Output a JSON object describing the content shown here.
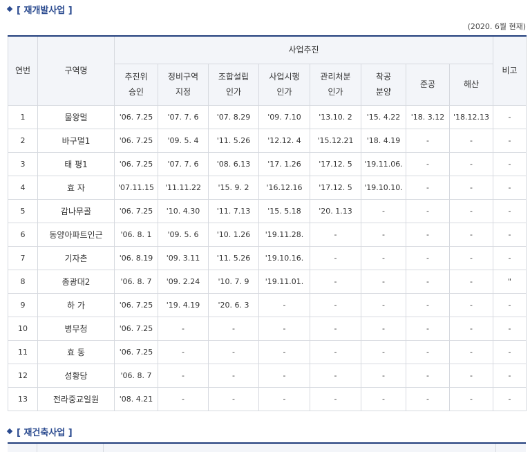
{
  "section1": {
    "title": "[ 재개발사업 ]"
  },
  "note": "(2020. 6월 현재)",
  "table": {
    "header": {
      "col_no": "연번",
      "col_name": "구역명",
      "group": "사업추진",
      "col_remark": "비고",
      "steps": [
        [
          "추진위",
          "승인"
        ],
        [
          "정비구역",
          "지정"
        ],
        [
          "조합설립",
          "인가"
        ],
        [
          "사업시행",
          "인가"
        ],
        [
          "관리처분",
          "인가"
        ],
        [
          "착공",
          "분양"
        ],
        [
          "준공"
        ],
        [
          "해산"
        ]
      ]
    },
    "rows": [
      [
        "1",
        "물왕멀",
        "'06. 7.25",
        "'07. 7. 6",
        "'07. 8.29",
        "'09. 7.10",
        "'13.10. 2",
        "'15. 4.22",
        "'18. 3.12",
        "'18.12.13",
        "-"
      ],
      [
        "2",
        "바구멀1",
        "'06. 7.25",
        "'09. 5. 4",
        "'11. 5.26",
        "'12.12. 4",
        "'15.12.21",
        "'18. 4.19",
        "-",
        "-",
        "-"
      ],
      [
        "3",
        "태 평1",
        "'06. 7.25",
        "'07. 7. 6",
        "'08. 6.13",
        "'17. 1.26",
        "'17.12. 5",
        "'19.11.06.",
        "-",
        "-",
        "-"
      ],
      [
        "4",
        "효 자",
        "'07.11.15",
        "'11.11.22",
        "'15. 9. 2",
        "'16.12.16",
        "'17.12. 5",
        "'19.10.10.",
        "-",
        "-",
        "-"
      ],
      [
        "5",
        "감나무골",
        "'06. 7.25",
        "'10. 4.30",
        "'11. 7.13",
        "'15. 5.18",
        "'20. 1.13",
        "-",
        "-",
        "-",
        "-"
      ],
      [
        "6",
        "동양아파트인근",
        "'06. 8. 1",
        "'09. 5. 6",
        "'10. 1.26",
        "'19.11.28.",
        "-",
        "-",
        "-",
        "-",
        "-"
      ],
      [
        "7",
        "기자촌",
        "'06. 8.19",
        "'09. 3.11",
        "'11. 5.26",
        "'19.10.16.",
        "-",
        "-",
        "-",
        "-",
        "-"
      ],
      [
        "8",
        "종광대2",
        "'06. 8. 7",
        "'09. 2.24",
        "'10. 7. 9",
        "'19.11.01.",
        "-",
        "-",
        "-",
        "-",
        "\""
      ],
      [
        "9",
        "하 가",
        "'06. 7.25",
        "'19. 4.19",
        "'20. 6. 3",
        "-",
        "-",
        "-",
        "-",
        "-",
        "-"
      ],
      [
        "10",
        "병무청",
        "'06. 7.25",
        "-",
        "-",
        "-",
        "-",
        "-",
        "-",
        "-",
        "-"
      ],
      [
        "11",
        "효 동",
        "'06. 7.25",
        "-",
        "-",
        "-",
        "-",
        "-",
        "-",
        "-",
        "-"
      ],
      [
        "12",
        "성황당",
        "'06. 8. 7",
        "-",
        "-",
        "-",
        "-",
        "-",
        "-",
        "-",
        "-"
      ],
      [
        "13",
        "전라중교일원",
        "'08. 4.21",
        "-",
        "-",
        "-",
        "-",
        "-",
        "-",
        "-",
        "-"
      ]
    ]
  },
  "section2": {
    "title": "[ 재건축사업 ]"
  },
  "colors": {
    "accent": "#2a4a8f",
    "table_border_top": "#1f3c7a",
    "header_bg": "#f3f5f9",
    "grid_line": "#d6d9df"
  }
}
